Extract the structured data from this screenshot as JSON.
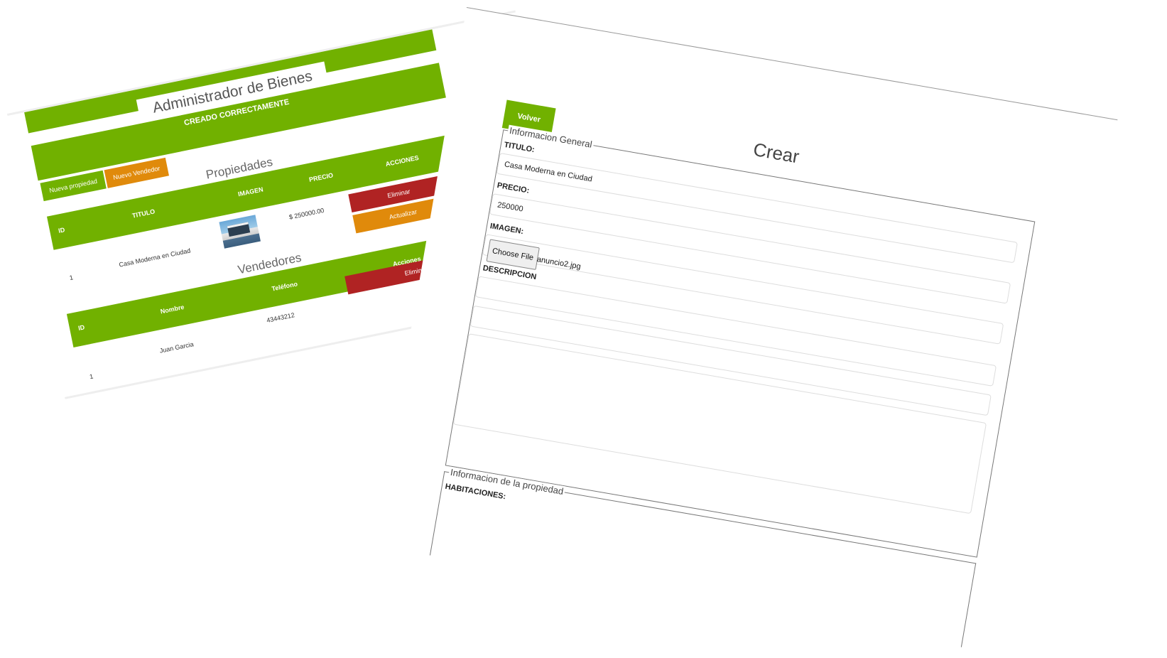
{
  "admin": {
    "title": "Administrador de Bienes Raices",
    "success_message": "CREADO CORRECTAMENTE",
    "buttons": {
      "new_property": "Nueva propiedad",
      "new_seller": "Nuevo Vendedor"
    },
    "properties": {
      "heading": "Propiedades",
      "columns": [
        "ID",
        "TITULO",
        "IMAGEN",
        "PRECIO",
        "ACCIONES"
      ],
      "rows": [
        {
          "id": "1",
          "title": "Casa Moderna en Ciudad",
          "price": "$ 250000.00"
        }
      ],
      "actions": {
        "delete": "Eliminar",
        "update": "Actualizar"
      }
    },
    "sellers": {
      "heading": "Vendedores",
      "columns": [
        "ID",
        "Nombre",
        "Teléfono",
        "Acciones"
      ],
      "rows": [
        {
          "id": "1",
          "name": "Juan Garcia",
          "phone": "43443212"
        }
      ],
      "actions": {
        "delete": "Eliminar"
      }
    }
  },
  "create_form": {
    "back_button": "Volver",
    "title": "Crear",
    "general_legend": "Informacion General",
    "titulo_label": "TITULO:",
    "titulo_value": "Casa Moderna en Ciudad",
    "precio_label": "PRECIO:",
    "precio_value": "250000",
    "imagen_label": "IMAGEN:",
    "file_button": "Choose File",
    "file_name": "anuncio2.jpg",
    "descripcion_label": "DESCRIPCION",
    "property_legend": "Informacion de la propiedad",
    "habitaciones_label": "HABITACIONES:"
  },
  "colors": {
    "green": "#71b100",
    "red": "#b02323",
    "orange": "#e08a0b"
  }
}
